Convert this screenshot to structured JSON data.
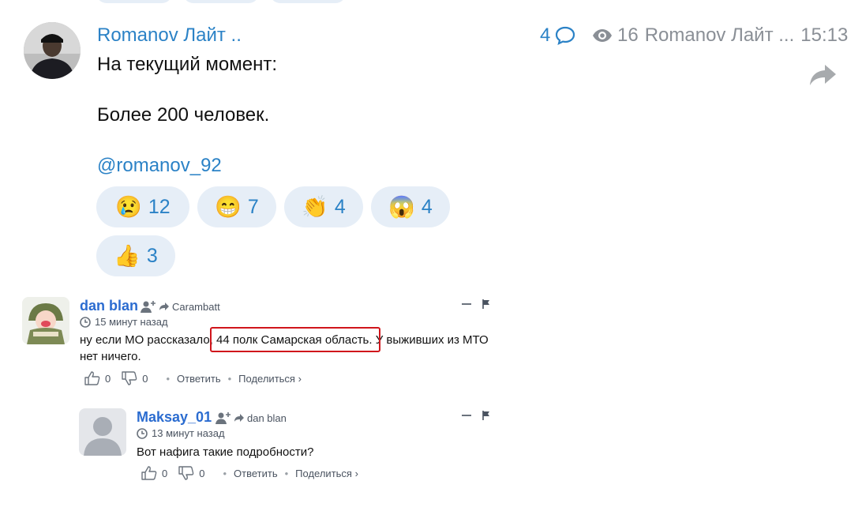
{
  "post": {
    "author": "Romanov Лайт ..",
    "comment_count": "4",
    "views": "16",
    "channel": "Romanov Лайт ...",
    "time": "15:13",
    "lines": [
      "На текущий момент:",
      "Более 200 человек."
    ],
    "mention": "@romanov_92",
    "reactions": [
      {
        "emoji": "😢",
        "count": "12"
      },
      {
        "emoji": "😁",
        "count": "7"
      },
      {
        "emoji": "👏",
        "count": "4"
      },
      {
        "emoji": "😱",
        "count": "4"
      },
      {
        "emoji": "👍",
        "count": "3"
      }
    ]
  },
  "comments": [
    {
      "author": "dan blan",
      "reply_to": "Carambatt",
      "time": "15 минут назад",
      "text_before": "ну если МО рассказало, ",
      "text_highlight": "44 полк Самарская область.",
      "text_after": " У выживших из МТО нет ничего.",
      "likes": "0",
      "dislikes": "0",
      "reply_label": "Ответить",
      "share_label": "Поделиться ›"
    },
    {
      "author": "Maksay_01",
      "reply_to": "dan blan",
      "time": "13 минут назад",
      "text": "Вот нафига такие подробности?",
      "likes": "0",
      "dislikes": "0",
      "reply_label": "Ответить",
      "share_label": "Поделиться ›"
    }
  ],
  "colors": {
    "accent": "#2b82c6",
    "pill": "#e6eef7",
    "highlight": "#d0161c",
    "author": "#2b6cd0"
  }
}
